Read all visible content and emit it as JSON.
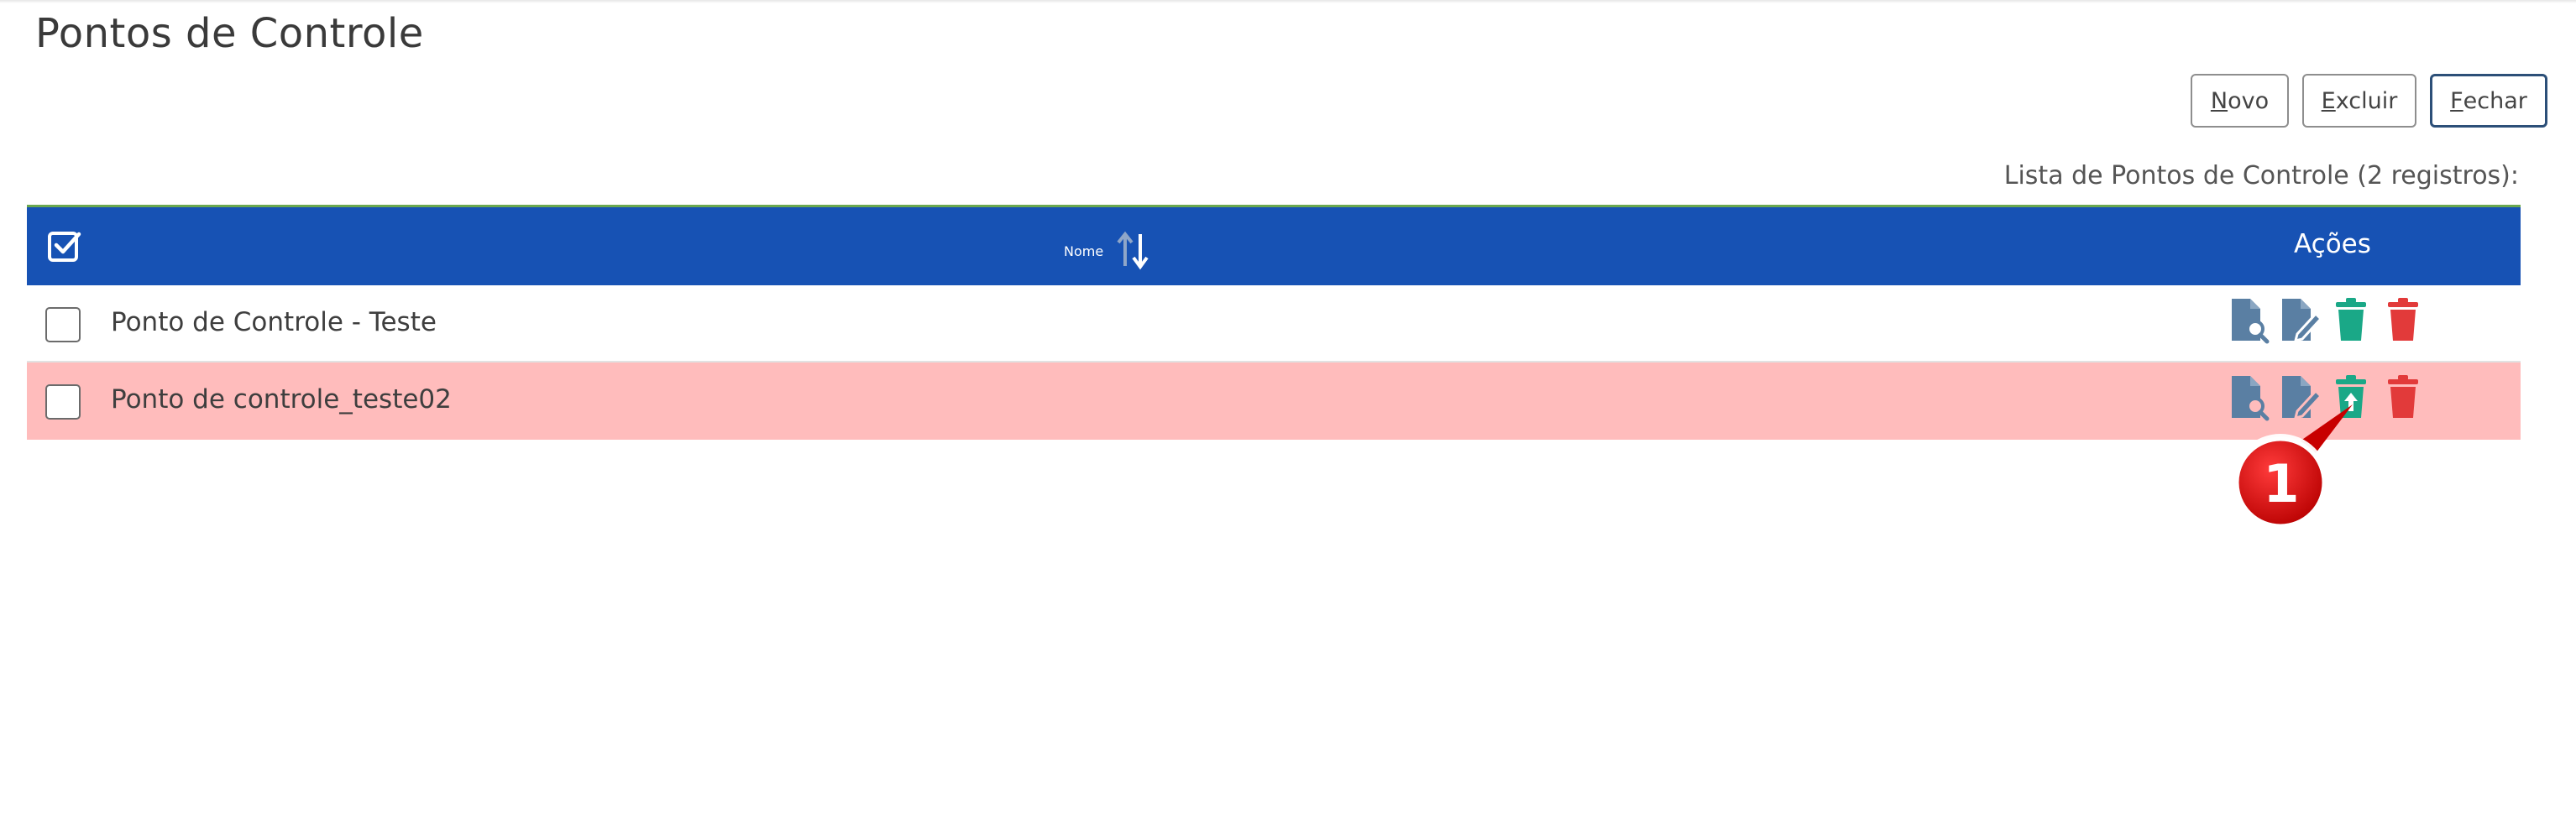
{
  "page": {
    "title": "Pontos de Controle"
  },
  "toolbar": {
    "novo": {
      "underlined": "N",
      "rest": "ovo"
    },
    "excluir": {
      "underlined": "E",
      "rest": "xcluir"
    },
    "fechar": {
      "underlined": "F",
      "rest": "echar"
    }
  },
  "list": {
    "caption": "Lista de Pontos de Controle (2 registros):",
    "columns": {
      "nome": "Nome",
      "acoes": "Ações"
    },
    "rows": [
      {
        "name": "Ponto de Controle - Teste",
        "highlighted": false,
        "actions": [
          "view-document-icon",
          "edit-document-icon",
          "trash-green-icon",
          "trash-red-icon"
        ]
      },
      {
        "name": "Ponto de controle_teste02",
        "highlighted": true,
        "actions": [
          "view-document-icon",
          "edit-document-icon",
          "restore-trash-icon",
          "trash-red-icon"
        ]
      }
    ]
  },
  "annotation": {
    "label": "1"
  },
  "colors": {
    "header_bg": "#1752b4",
    "highlight_row": "#ffbcbc",
    "green_action": "#1aa887",
    "red_action": "#e23a3a",
    "doc_icon": "#5a7fa3",
    "callout": "#d40000"
  }
}
